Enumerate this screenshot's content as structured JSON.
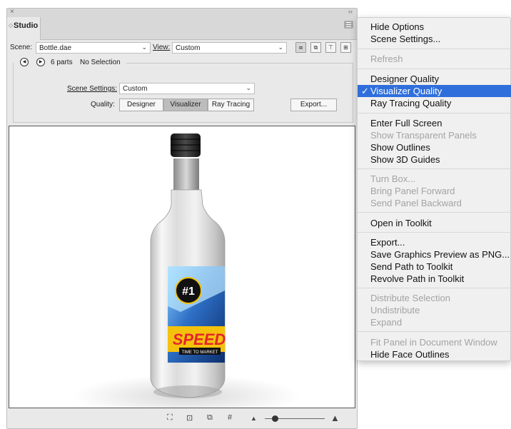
{
  "panel": {
    "tab_label": "Studio",
    "scene_label": "Scene:",
    "scene_value": "Bottle.dae",
    "view_label": "View:",
    "view_value": "Custom",
    "parts_text": "6 parts",
    "selection_text": "No Selection",
    "scene_settings_label": "Scene Settings:",
    "scene_settings_value": "Custom",
    "quality_label": "Quality:",
    "quality_options": [
      "Designer",
      "Visualizer",
      "Ray Tracing"
    ],
    "quality_selected": "Visualizer",
    "export_label": "Export...",
    "zoom_level": 0.17
  },
  "label": {
    "number": "#1",
    "brand": "SPEED",
    "tagline": "TIME TO MARKET"
  },
  "menu": {
    "items": [
      {
        "label": "Hide Options",
        "enabled": true
      },
      {
        "label": "Scene Settings...",
        "enabled": true
      },
      {
        "label": "Refresh",
        "enabled": false
      },
      {
        "label": "Designer Quality",
        "enabled": true
      },
      {
        "label": "Visualizer Quality",
        "enabled": true,
        "checked": true
      },
      {
        "label": "Ray Tracing Quality",
        "enabled": true
      },
      {
        "label": "Enter Full Screen",
        "enabled": true
      },
      {
        "label": "Show Transparent Panels",
        "enabled": false
      },
      {
        "label": "Show Outlines",
        "enabled": true
      },
      {
        "label": "Show 3D Guides",
        "enabled": true
      },
      {
        "label": "Turn Box...",
        "enabled": false
      },
      {
        "label": "Bring Panel Forward",
        "enabled": false
      },
      {
        "label": "Send Panel Backward",
        "enabled": false
      },
      {
        "label": "Open in Toolkit",
        "enabled": true
      },
      {
        "label": "Export...",
        "enabled": true
      },
      {
        "label": "Save Graphics Preview as PNG...",
        "enabled": true
      },
      {
        "label": "Send Path to Toolkit",
        "enabled": true
      },
      {
        "label": "Revolve Path in Toolkit",
        "enabled": true
      },
      {
        "label": "Distribute Selection",
        "enabled": false
      },
      {
        "label": "Undistribute",
        "enabled": false
      },
      {
        "label": "Expand",
        "enabled": false
      },
      {
        "label": "Fit Panel in Document Window",
        "enabled": false
      },
      {
        "label": "Hide Face Outlines",
        "enabled": true
      }
    ]
  },
  "colors": {
    "highlight": "#2f6fdc",
    "label_yellow": "#f4c20d",
    "label_red": "#e3262b"
  }
}
